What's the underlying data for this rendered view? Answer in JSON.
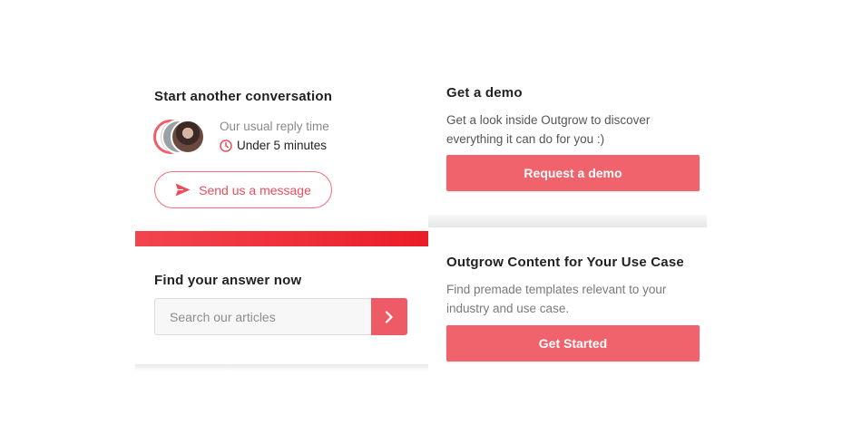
{
  "conversation": {
    "title": "Start another conversation",
    "reply_label": "Our usual reply time",
    "reply_time": "Under 5 minutes",
    "send_label": "Send us a message"
  },
  "find": {
    "title": "Find your answer now",
    "search_placeholder": "Search our articles"
  },
  "demo": {
    "title": "Get a demo",
    "description": "Get a look inside Outgrow to discover everything it can do for you :)",
    "button": "Request a demo"
  },
  "content": {
    "title": "Outgrow Content for Your Use Case",
    "description": "Find premade templates relevant to your industry and use case.",
    "button": "Get Started"
  },
  "icons": {
    "clock": "clock-icon",
    "send": "paper-plane-icon",
    "search_arrow": "chevron-right-icon"
  },
  "colors": {
    "accent": "#f0626c",
    "accent_dark": "#ea1d28",
    "outline": "#f2707a"
  }
}
